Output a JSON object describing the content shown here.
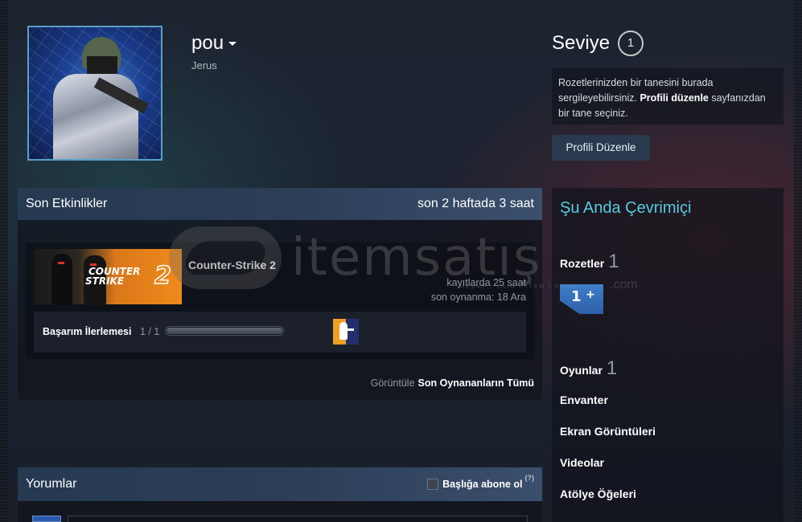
{
  "profile": {
    "persona_name": "pou",
    "real_name": "Jerus"
  },
  "level": {
    "title": "Seviye",
    "value": "1",
    "badge_info_part1": "Rozetlerinizden bir tanesini burada sergileyebilirsiniz. ",
    "badge_info_bold": "Profili düzenle",
    "badge_info_part2": " sayfanızdan bir tane seçiniz.",
    "edit_button": "Profili Düzenle"
  },
  "recent_activity": {
    "title": "Son Etkinlikler",
    "summary": "son 2 haftada 3 saat",
    "game": {
      "name": "Counter-Strike 2",
      "banner_line1": "COUNTER",
      "banner_line2": "STRIKE",
      "banner_number": "2",
      "hours_on_record": "kayıtlarda 25 saat",
      "last_played": "son oynanma: 18 Ara",
      "achievement_label": "Başarım İlerlemesi",
      "achievement_count": "1 / 1",
      "achievement_progress": 1.0
    },
    "view_label": "Görüntüle",
    "view_link": "Son Oynananların Tümü"
  },
  "comments": {
    "title": "Yorumlar",
    "subscribe_label": "Başlığa abone ol",
    "help_mark": "(?)"
  },
  "sidebar": {
    "status": "Şu Anda Çevrimiçi",
    "badges_label": "Rozetler",
    "badges_count": "1",
    "badge_icon_text": "1",
    "badge_icon_plus": "+",
    "games_label": "Oyunlar",
    "games_count": "1",
    "inventory": "Envanter",
    "screenshots": "Ekran Görüntüleri",
    "videos": "Videolar",
    "workshop": "Atölye Öğeleri"
  },
  "watermark": {
    "brand": "itemsatış",
    "tagline": "HESAP / SKIN / ITEM / E-PIN",
    "domain": ".com"
  },
  "colors": {
    "accent_online": "#57cbde",
    "header_gradient_start": "#263a52",
    "button_bg": "#2a3a4e"
  }
}
